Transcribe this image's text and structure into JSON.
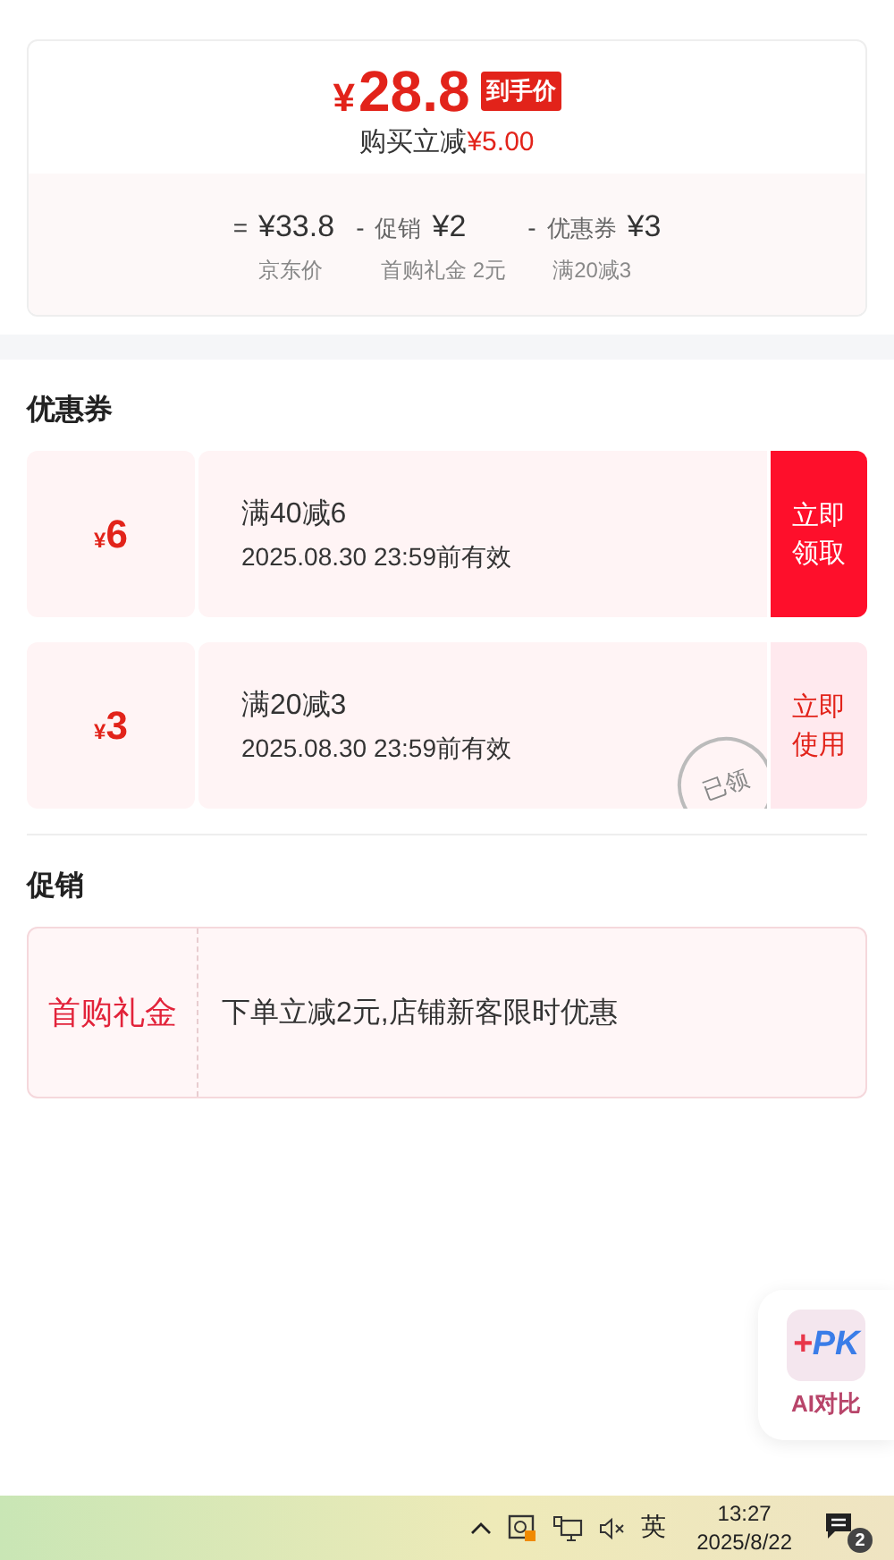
{
  "price_card": {
    "currency": "¥",
    "price": "28.8",
    "tag": "到手价",
    "saving_label": "购买立减",
    "saving_value": "¥5.00",
    "breakdown": [
      {
        "op": "=",
        "value": "¥33.8",
        "note": "京东价"
      },
      {
        "op": "-",
        "name": "促销",
        "value": "¥2",
        "note": "首购礼金 2元"
      },
      {
        "op": "-",
        "name": "优惠券",
        "value": "¥3",
        "note": "满20减3"
      }
    ]
  },
  "coupons_section": {
    "title": "优惠券",
    "coupons": [
      {
        "currency": "¥",
        "amount": "6",
        "rule": "满40减6",
        "validity": "2025.08.30 23:59前有效",
        "action": "立即领取",
        "claimed": false
      },
      {
        "currency": "¥",
        "amount": "3",
        "rule": "满20减3",
        "validity": "2025.08.30 23:59前有效",
        "action": "立即使用",
        "claimed": true,
        "stamp": "已领"
      }
    ]
  },
  "promo_section": {
    "title": "促销",
    "promos": [
      {
        "name": "首购礼金",
        "text": "下单立减2元,店铺新客限时优惠"
      }
    ]
  },
  "float_button": {
    "logo_plus": "+",
    "logo_text": "PK",
    "label": "AI对比"
  },
  "taskbar": {
    "ime": "英",
    "time": "13:27",
    "date": "2025/8/22",
    "notifications": "2"
  }
}
